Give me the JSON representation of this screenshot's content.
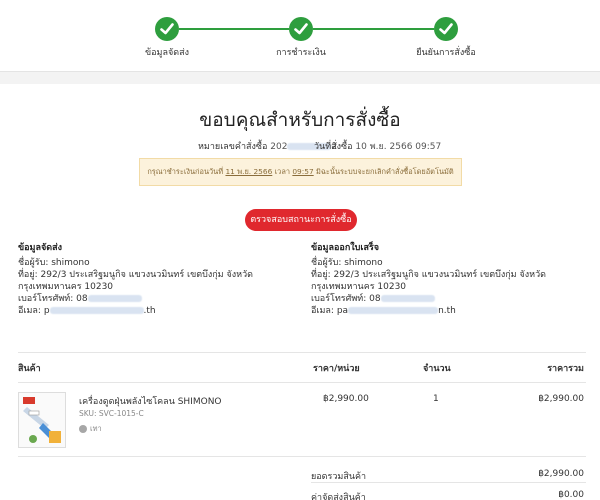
{
  "steps": [
    {
      "label": "ข้อมูลจัดส่ง"
    },
    {
      "label": "การชำระเงิน"
    },
    {
      "label": "ยืนยันการสั่งซื้อ"
    }
  ],
  "colors": {
    "accent_green": "#2e9e3e",
    "button_red": "#e0282e",
    "notice_bg": "#fcf2dc"
  },
  "header": {
    "title": "ขอบคุณสำหรับการสั่งซื้อ",
    "order_no_label": "หมายเลขคำสั่งซื้อ",
    "order_no_prefix": "202",
    "order_no_suffix": "2",
    "order_date_label": "วันที่สั่งซื้อ",
    "order_date_value": "10 พ.ย. 2566 09:57"
  },
  "notice": {
    "before": "กรุณาชำระเงินก่อนวันที่",
    "date": "11 พ.ย. 2566",
    "time_label": "เวลา",
    "time": "09:57",
    "after": "มิฉะนั้นระบบจะยกเลิกคำสั่งซื้อโดยอัตโนมัติ"
  },
  "check_status_button": "ตรวจสอบสถานะการสั่งซื้อ",
  "shipping": {
    "title": "ข้อมูลจัดส่ง",
    "recipient": "ชื่อผู้รับ: shimono",
    "address1": "ที่อยู่: 292/3 ประเสริฐมนูกิจ แขวงนวมินทร์ เขตบึงกุ่ม จังหวัด",
    "address2": "กรุงเทพมหานคร 10230",
    "phone_prefix": "เบอร์โทรศัพท์: 08",
    "email_prefix": "อีเมล: p",
    "email_suffix": ".th"
  },
  "billing": {
    "title": "ข้อมูลออกใบเสร็จ",
    "recipient": "ชื่อผู้รับ: shimono",
    "address1": "ที่อยู่: 292/3 ประเสริฐมนูกิจ แขวงนวมินทร์ เขตบึงกุ่ม จังหวัด",
    "address2": "กรุงเทพมหานคร 10230",
    "phone_prefix": "เบอร์โทรศัพท์: 08",
    "email_prefix": "อีเมล: pa",
    "email_suffix": "n.th"
  },
  "table": {
    "headers": {
      "product": "สินค้า",
      "unit_price": "ราคา/หน่วย",
      "qty": "จำนวน",
      "total": "ราคารวม"
    },
    "rows": [
      {
        "name": "เครื่องดูดฝุ่นพลังไซโคลน SHIMONO",
        "sku": "SKU: SVC-1015-C",
        "color": "เทา",
        "unit_price": "฿2,990.00",
        "qty": "1",
        "total": "฿2,990.00"
      }
    ]
  },
  "summary": {
    "subtotal_label": "ยอดรวมสินค้า",
    "subtotal_value": "฿2,990.00",
    "shipping_label": "ค่าจัดส่งสินค้า",
    "shipping_value": "฿0.00"
  }
}
